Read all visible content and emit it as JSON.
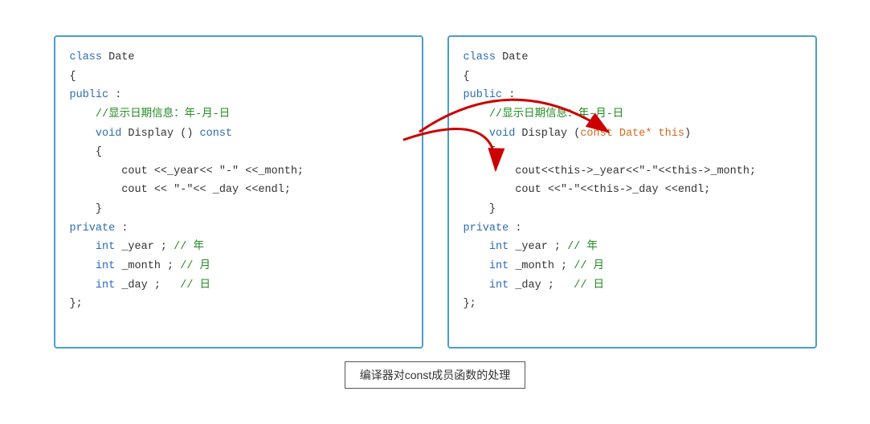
{
  "caption": "编译器对const成员函数的处理",
  "left_panel": {
    "lines": [
      {
        "parts": [
          {
            "text": "class ",
            "cls": "kw-blue"
          },
          {
            "text": "Date",
            "cls": "kw-black"
          }
        ]
      },
      {
        "parts": [
          {
            "text": "{",
            "cls": "kw-black"
          }
        ]
      },
      {
        "parts": [
          {
            "text": "public",
            "cls": "kw-blue"
          },
          {
            "text": " :",
            "cls": "kw-black"
          }
        ]
      },
      {
        "parts": [
          {
            "text": "    //显示日期信息：年-月-日",
            "cls": "kw-comment"
          }
        ]
      },
      {
        "parts": [
          {
            "text": "    ",
            "cls": ""
          },
          {
            "text": "void",
            "cls": "kw-blue"
          },
          {
            "text": " Display () ",
            "cls": "kw-black"
          },
          {
            "text": "const",
            "cls": "kw-blue"
          }
        ]
      },
      {
        "parts": [
          {
            "text": "    {",
            "cls": "kw-black"
          }
        ]
      },
      {
        "parts": [
          {
            "text": "        cout <<_year<< \"-\" <<_month;",
            "cls": "kw-black"
          }
        ]
      },
      {
        "parts": [
          {
            "text": "        cout << \"-\"<< _day <<endl;",
            "cls": "kw-black"
          }
        ]
      },
      {
        "parts": [
          {
            "text": "    }",
            "cls": "kw-black"
          }
        ]
      },
      {
        "parts": [
          {
            "text": "private",
            "cls": "kw-blue"
          },
          {
            "text": " :",
            "cls": "kw-black"
          }
        ]
      },
      {
        "parts": [
          {
            "text": "    ",
            "cls": ""
          },
          {
            "text": "int",
            "cls": "kw-blue"
          },
          {
            "text": " _year ; ",
            "cls": "kw-black"
          },
          {
            "text": "// 年",
            "cls": "kw-comment"
          }
        ]
      },
      {
        "parts": [
          {
            "text": "    ",
            "cls": ""
          },
          {
            "text": "int",
            "cls": "kw-blue"
          },
          {
            "text": " _month ; ",
            "cls": "kw-black"
          },
          {
            "text": "// 月",
            "cls": "kw-comment"
          }
        ]
      },
      {
        "parts": [
          {
            "text": "    ",
            "cls": ""
          },
          {
            "text": "int",
            "cls": "kw-blue"
          },
          {
            "text": " _day ;   ",
            "cls": "kw-black"
          },
          {
            "text": "// 日",
            "cls": "kw-comment"
          }
        ]
      },
      {
        "parts": [
          {
            "text": "};",
            "cls": "kw-black"
          }
        ]
      }
    ]
  },
  "right_panel": {
    "lines": [
      {
        "parts": [
          {
            "text": "class ",
            "cls": "kw-blue"
          },
          {
            "text": "Date",
            "cls": "kw-black"
          }
        ]
      },
      {
        "parts": [
          {
            "text": "{",
            "cls": "kw-black"
          }
        ]
      },
      {
        "parts": [
          {
            "text": "public",
            "cls": "kw-blue"
          },
          {
            "text": " :",
            "cls": "kw-black"
          }
        ]
      },
      {
        "parts": [
          {
            "text": "    //显示日期信息：年-月-日",
            "cls": "kw-comment"
          }
        ]
      },
      {
        "parts": [
          {
            "text": "    ",
            "cls": ""
          },
          {
            "text": "void",
            "cls": "kw-blue"
          },
          {
            "text": " Display (",
            "cls": "kw-black"
          },
          {
            "text": "const Date* this",
            "cls": "kw-orange"
          },
          {
            "text": ")",
            "cls": "kw-black"
          }
        ]
      },
      {
        "parts": [
          {
            "text": "    {",
            "cls": "kw-black"
          }
        ]
      },
      {
        "parts": [
          {
            "text": "        cout<<this->_year<<\"-\"<<this->_month;",
            "cls": "kw-black"
          }
        ]
      },
      {
        "parts": [
          {
            "text": "        cout <<\"-\"<<this->_day <<endl;",
            "cls": "kw-black"
          }
        ]
      },
      {
        "parts": [
          {
            "text": "    }",
            "cls": "kw-black"
          }
        ]
      },
      {
        "parts": [
          {
            "text": "private",
            "cls": "kw-blue"
          },
          {
            "text": " :",
            "cls": "kw-black"
          }
        ]
      },
      {
        "parts": [
          {
            "text": "    ",
            "cls": ""
          },
          {
            "text": "int",
            "cls": "kw-blue"
          },
          {
            "text": " _year ; ",
            "cls": "kw-black"
          },
          {
            "text": "// 年",
            "cls": "kw-comment"
          }
        ]
      },
      {
        "parts": [
          {
            "text": "    ",
            "cls": ""
          },
          {
            "text": "int",
            "cls": "kw-blue"
          },
          {
            "text": " _month ; ",
            "cls": "kw-black"
          },
          {
            "text": "// 月",
            "cls": "kw-comment"
          }
        ]
      },
      {
        "parts": [
          {
            "text": "    ",
            "cls": ""
          },
          {
            "text": "int",
            "cls": "kw-blue"
          },
          {
            "text": " _day ;   ",
            "cls": "kw-black"
          },
          {
            "text": "// 日",
            "cls": "kw-comment"
          }
        ]
      },
      {
        "parts": [
          {
            "text": "};",
            "cls": "kw-black"
          }
        ]
      }
    ]
  }
}
